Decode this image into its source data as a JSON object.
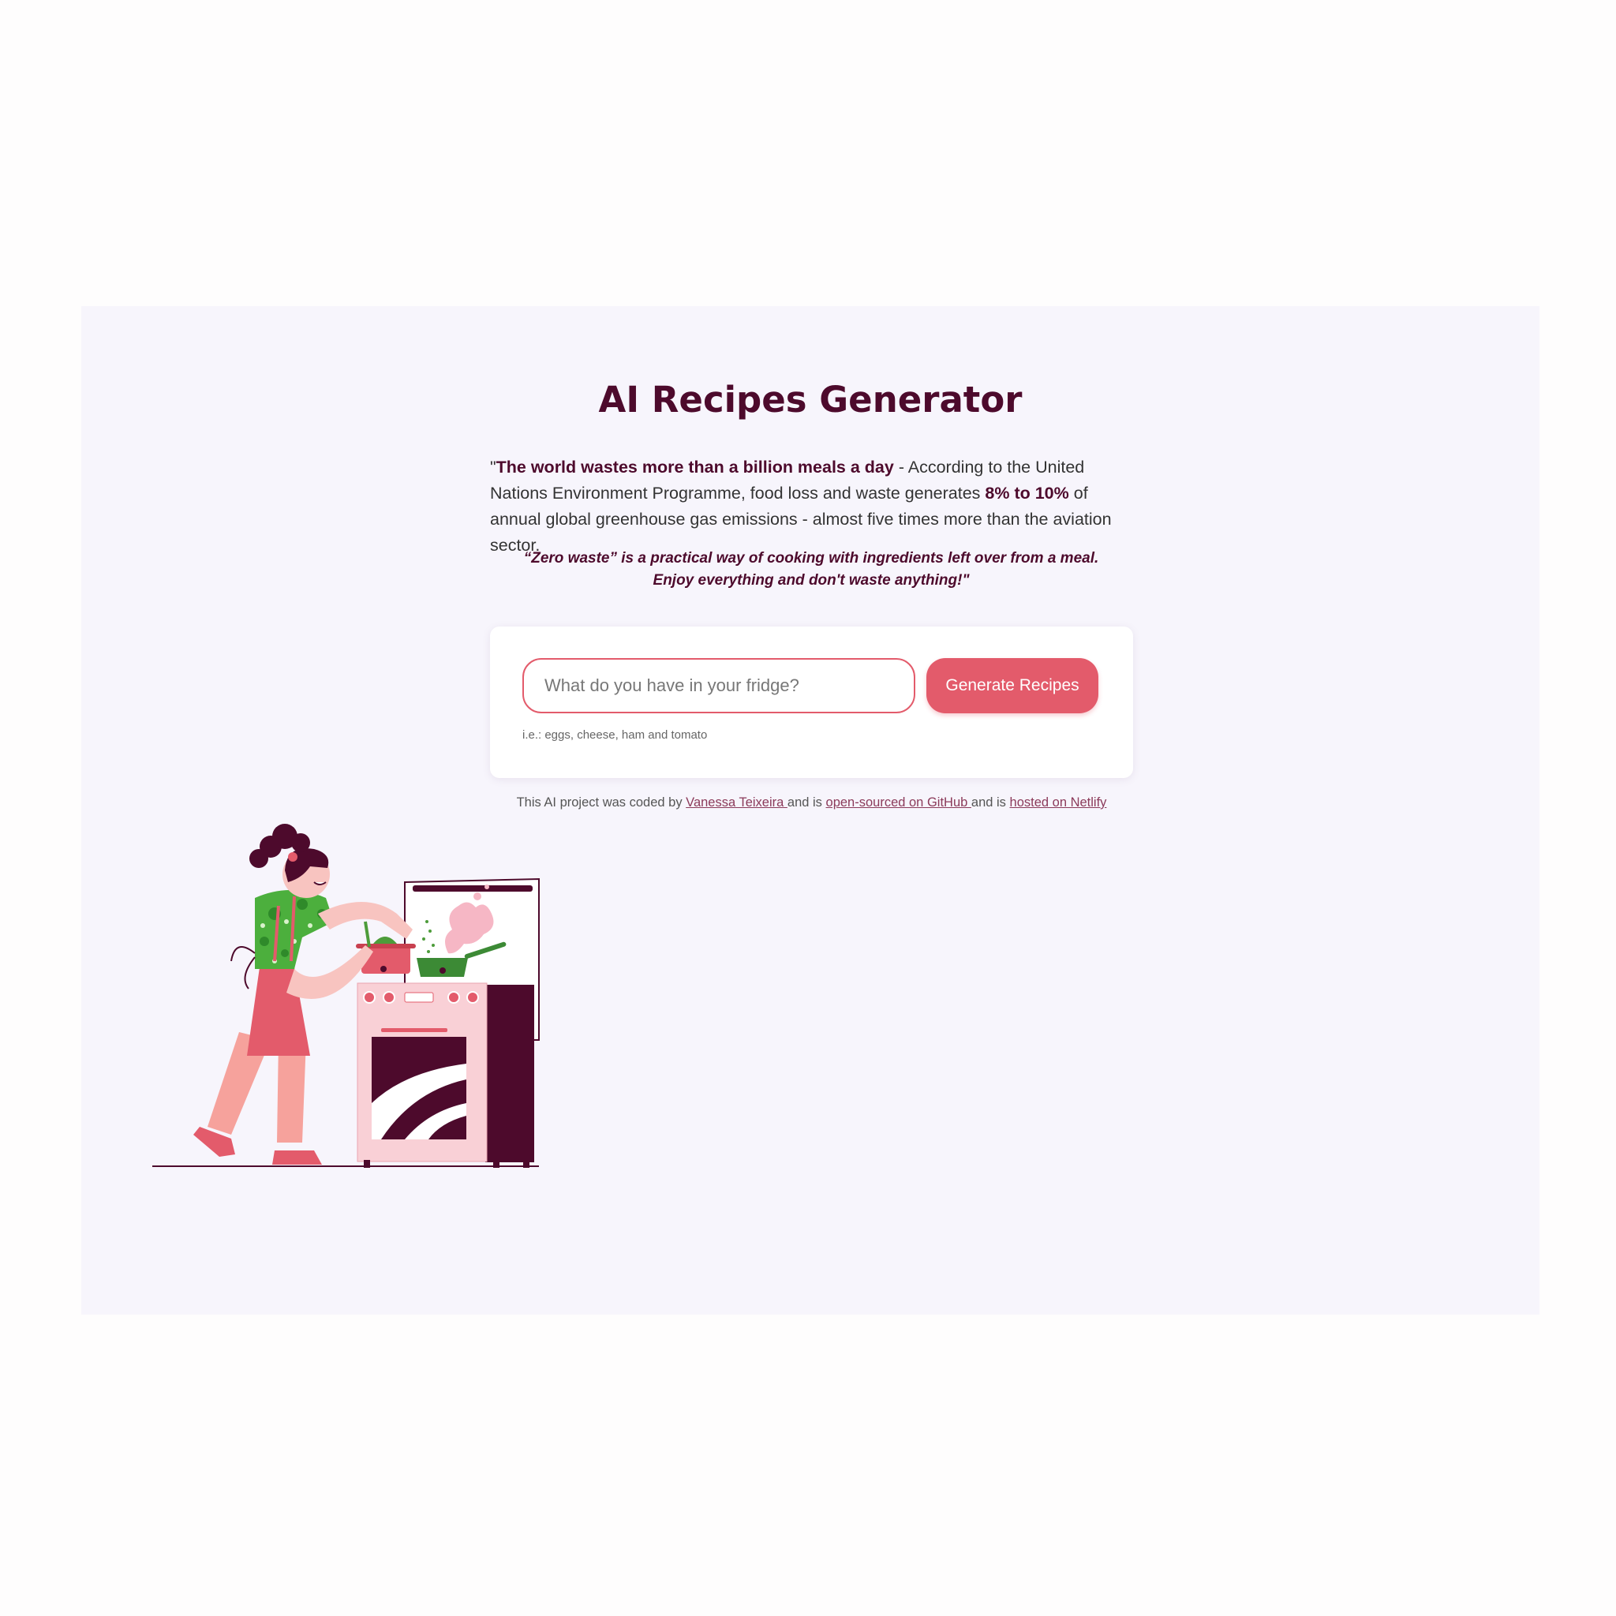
{
  "page": {
    "title": "AI Recipes Generator"
  },
  "intro": {
    "open_quote": "\"",
    "bold_statement": "The world wastes more than a billion meals a day",
    "text_part1": " - According to the United Nations Environment Programme, food loss and waste generates ",
    "bold_percent": "8% to 10%",
    "text_part2": " of annual global greenhouse gas emissions - almost five times more than the aviation sector."
  },
  "quote": "“Zero waste” is a practical way of cooking with ingredients left over from a meal. Enjoy everything and don't waste anything!\"",
  "form": {
    "placeholder": "What do you have in your fridge?",
    "value": "",
    "button_label": "Generate Recipes",
    "hint": "i.e.: eggs, cheese, ham and tomato"
  },
  "credits": {
    "text1": "This AI project was coded by ",
    "author_link": "Vanessa Teixeira ",
    "text2": "and is ",
    "github_link": "open-sourced on GitHub ",
    "text3": "and is ",
    "netlify_link": "hosted on Netlify"
  },
  "illustration": {
    "icon": "woman-cooking-at-stove-illustration"
  },
  "colors": {
    "accent": "#e35b6b",
    "heading": "#4d0a2c",
    "panel_bg": "#f7f5fc",
    "link": "#8b3a5a"
  }
}
